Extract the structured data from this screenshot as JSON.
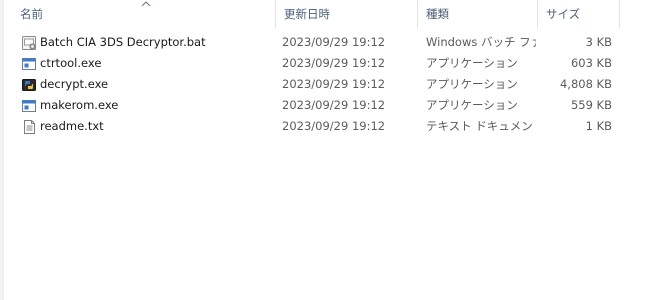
{
  "columns": {
    "name": "名前",
    "date": "更新日時",
    "type": "種類",
    "size": "サイズ"
  },
  "files": [
    {
      "name": "Batch CIA 3DS Decryptor.bat",
      "date": "2023/09/29 19:12",
      "type": "Windows バッチ ファ...",
      "size": "3 KB",
      "icon": "batch-file-icon"
    },
    {
      "name": "ctrtool.exe",
      "date": "2023/09/29 19:12",
      "type": "アプリケーション",
      "size": "603 KB",
      "icon": "application-icon"
    },
    {
      "name": "decrypt.exe",
      "date": "2023/09/29 19:12",
      "type": "アプリケーション",
      "size": "4,808 KB",
      "icon": "python-exe-icon"
    },
    {
      "name": "makerom.exe",
      "date": "2023/09/29 19:12",
      "type": "アプリケーション",
      "size": "559 KB",
      "icon": "application-icon"
    },
    {
      "name": "readme.txt",
      "date": "2023/09/29 19:12",
      "type": "テキスト ドキュメント",
      "size": "1 KB",
      "icon": "text-document-icon"
    }
  ]
}
